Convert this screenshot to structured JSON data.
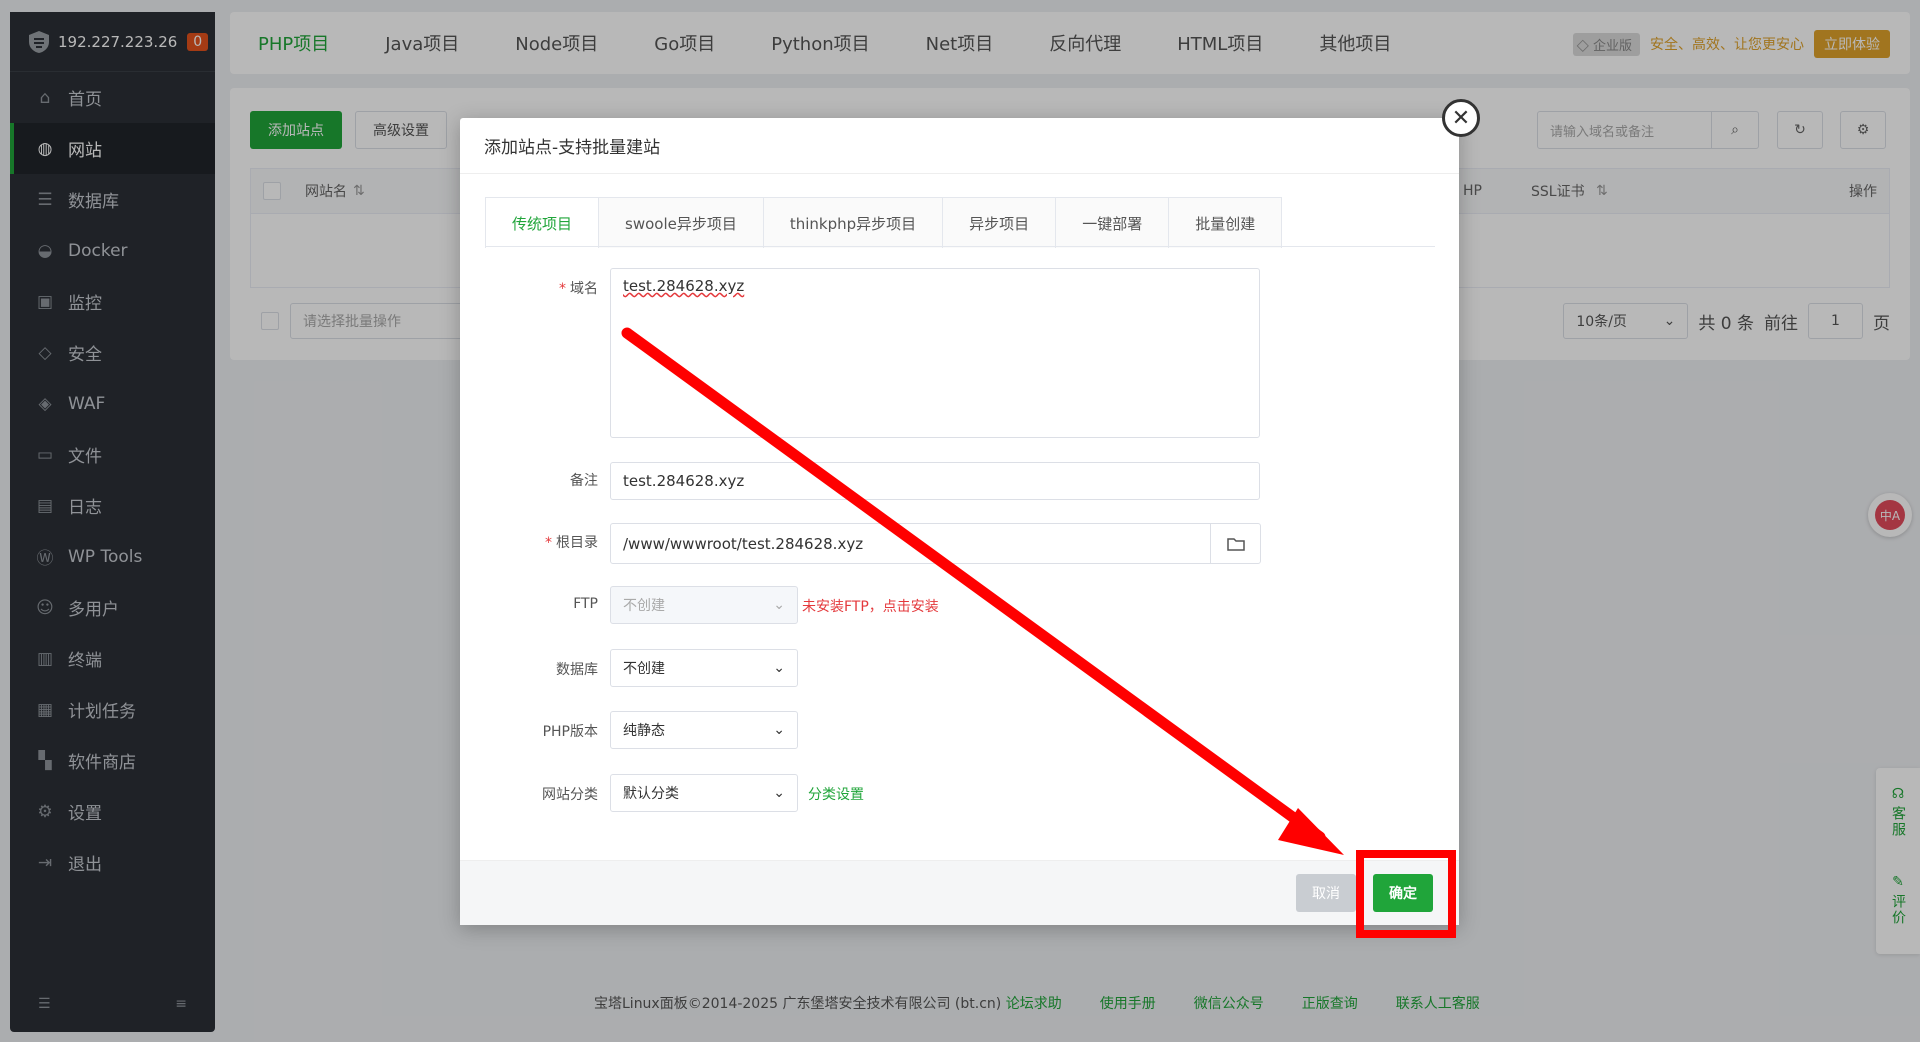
{
  "sidebar": {
    "ip": "192.227.223.26",
    "badge": "0",
    "items": [
      {
        "label": "首页",
        "icon": "home-icon"
      },
      {
        "label": "网站",
        "icon": "globe-icon",
        "active": true
      },
      {
        "label": "数据库",
        "icon": "database-icon"
      },
      {
        "label": "Docker",
        "icon": "docker-icon"
      },
      {
        "label": "监控",
        "icon": "monitor-icon"
      },
      {
        "label": "安全",
        "icon": "shield-icon"
      },
      {
        "label": "WAF",
        "icon": "waf-icon"
      },
      {
        "label": "文件",
        "icon": "folder-icon"
      },
      {
        "label": "日志",
        "icon": "log-icon"
      },
      {
        "label": "WP Tools",
        "icon": "wordpress-icon"
      },
      {
        "label": "多用户",
        "icon": "users-icon"
      },
      {
        "label": "终端",
        "icon": "terminal-icon"
      },
      {
        "label": "计划任务",
        "icon": "calendar-icon"
      },
      {
        "label": "软件商店",
        "icon": "apps-icon"
      },
      {
        "label": "设置",
        "icon": "gear-icon"
      },
      {
        "label": "退出",
        "icon": "logout-icon"
      }
    ]
  },
  "topnav": {
    "tabs": [
      "PHP项目",
      "Java项目",
      "Node项目",
      "Go项目",
      "Python项目",
      "Net项目",
      "反向代理",
      "HTML项目",
      "其他项目"
    ],
    "active": "PHP项目",
    "enterprise_label": "企业版",
    "slogan": "安全、高效、让您更安心",
    "try_button": "立即体验"
  },
  "toolbar": {
    "add_site": "添加站点",
    "advanced": "高级设置",
    "search_placeholder": "请输入域名或备注"
  },
  "table": {
    "columns": {
      "site_name": "网站名",
      "php": "HP",
      "ssl": "SSL证书",
      "actions": "操作"
    }
  },
  "pagination": {
    "batch_placeholder": "请选择批量操作",
    "page_size": "10条/页",
    "total": "共 0 条",
    "goto": "前往",
    "page_value": "1",
    "page_suffix": "页"
  },
  "modal": {
    "title": "添加站点-支持批量建站",
    "tabs": [
      "传统项目",
      "swoole异步项目",
      "thinkphp异步项目",
      "异步项目",
      "一键部署",
      "批量创建"
    ],
    "active_tab": "传统项目",
    "fields": {
      "domain_label": "域名",
      "domain_value": "test.284628.xyz",
      "remark_label": "备注",
      "remark_value": "test.284628.xyz",
      "root_label": "根目录",
      "root_value": "/www/wwwroot/test.284628.xyz",
      "ftp_label": "FTP",
      "ftp_value": "不创建",
      "ftp_hint": "未安装FTP，点击安装",
      "db_label": "数据库",
      "db_value": "不创建",
      "php_label": "PHP版本",
      "php_value": "纯静态",
      "category_label": "网站分类",
      "category_value": "默认分类",
      "category_link": "分类设置"
    },
    "cancel": "取消",
    "confirm": "确定"
  },
  "footer": {
    "copyright": "宝塔Linux面板©2014-2025 广东堡塔安全技术有限公司 (bt.cn)",
    "links": [
      "论坛求助",
      "使用手册",
      "微信公众号",
      "正版查询",
      "联系人工客服"
    ]
  },
  "floating": {
    "translate": "中A",
    "service": "客服",
    "review": "评价"
  },
  "colors": {
    "brand_green": "#20a53a",
    "annotation_red": "#ff0000",
    "sidebar_bg": "#2c3036",
    "gold": "#e0a32b"
  }
}
